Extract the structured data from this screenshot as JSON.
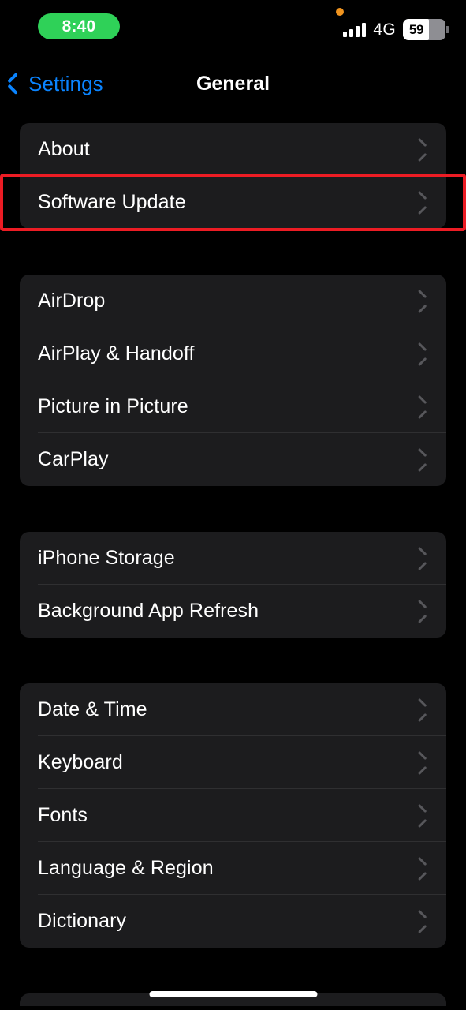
{
  "status_bar": {
    "time": "8:40",
    "time_pill_color": "#2fd158",
    "privacy_indicator": "orange-dot",
    "signal_icon": "cellular-signal-icon",
    "signal_bars": 4,
    "network": "4G",
    "battery_percent": "59",
    "battery_fill_color": "#ffffff",
    "battery_shell_color": "#8e8e93"
  },
  "navbar": {
    "back_label": "Settings",
    "back_icon": "chevron-left-icon",
    "back_color": "#0a84ff",
    "title": "General"
  },
  "groups": [
    {
      "rows": [
        {
          "label": "About",
          "highlighted": false
        },
        {
          "label": "Software Update",
          "highlighted": true
        }
      ]
    },
    {
      "rows": [
        {
          "label": "AirDrop",
          "highlighted": false
        },
        {
          "label": "AirPlay & Handoff",
          "highlighted": false
        },
        {
          "label": "Picture in Picture",
          "highlighted": false
        },
        {
          "label": "CarPlay",
          "highlighted": false
        }
      ]
    },
    {
      "rows": [
        {
          "label": "iPhone Storage",
          "highlighted": false
        },
        {
          "label": "Background App Refresh",
          "highlighted": false
        }
      ]
    },
    {
      "rows": [
        {
          "label": "Date & Time",
          "highlighted": false
        },
        {
          "label": "Keyboard",
          "highlighted": false
        },
        {
          "label": "Fonts",
          "highlighted": false
        },
        {
          "label": "Language & Region",
          "highlighted": false
        },
        {
          "label": "Dictionary",
          "highlighted": false
        }
      ]
    }
  ],
  "partial_group_visible": true,
  "highlight_color": "#ec1c24",
  "home_indicator": "home-indicator"
}
